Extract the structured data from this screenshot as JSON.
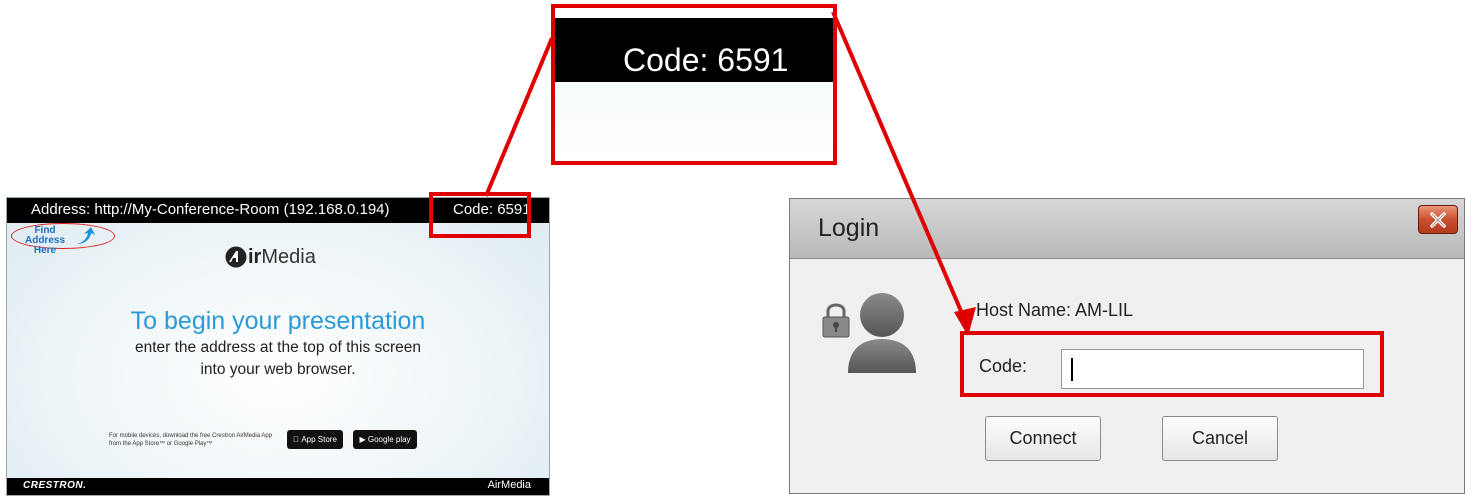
{
  "airmedia_screen": {
    "address": "Address: http://My-Conference-Room (192.168.0.194)",
    "code": "Code: 6591",
    "find_address_label": "Find Address Here",
    "logo_air": "ir",
    "logo_media": "Media",
    "headline": "To begin your presentation",
    "subline1": "enter the address at the top of this screen",
    "subline2": "into your web browser.",
    "mobile_text": "For mobile devices, download the free Crestron AirMedia App from the App Store™ or Google Play™",
    "app_store_badge": "App Store",
    "google_play_badge": "Google play",
    "footer_brand": "CRESTRON.",
    "footer_logo": "AirMedia"
  },
  "zoom": {
    "code": "Code: 6591"
  },
  "login_dialog": {
    "title": "Login",
    "host_name": "Host Name: AM-LIL",
    "code_label": "Code:",
    "code_value": "",
    "connect_label": "Connect",
    "cancel_label": "Cancel"
  },
  "colors": {
    "highlight": "#e00000",
    "headline_blue": "#2b9ad6",
    "close_button": "#c9502f"
  }
}
